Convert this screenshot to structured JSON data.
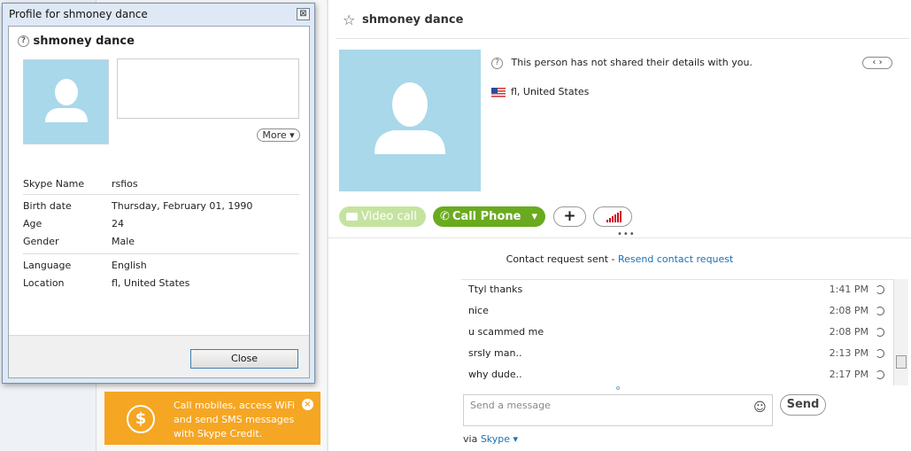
{
  "dialog": {
    "title": "Profile for shmoney dance",
    "close_x": "⊠",
    "name": "shmoney dance",
    "more_label": "More ▾",
    "fields": [
      {
        "key": "Skype Name",
        "value": "rsfios"
      },
      {
        "key": "Birth date",
        "value": "Thursday, February 01, 1990"
      },
      {
        "key": "Age",
        "value": "24"
      },
      {
        "key": "Gender",
        "value": "Male"
      },
      {
        "key": "Language",
        "value": "English"
      },
      {
        "key": "Location",
        "value": "fl, United States"
      }
    ],
    "close_button": "Close"
  },
  "ad": {
    "text": "Call mobiles, access WiFi and send SMS messages with Skype Credit.",
    "coin": "$",
    "close": "×"
  },
  "contact": {
    "name": "shmoney dance",
    "star": "☆",
    "not_shared": "This person has not shared their details with you.",
    "location": "fl, United States",
    "nav": "‹ ›"
  },
  "actions": {
    "video": "Video call",
    "call": "Call Phone",
    "call_arrow": "▾",
    "plus": "+"
  },
  "request": {
    "sent": "Contact request sent - ",
    "resend": "Resend contact request"
  },
  "messages": [
    {
      "text": "Ttyl thanks",
      "time": "1:41 PM"
    },
    {
      "text": "nice",
      "time": "2:08 PM"
    },
    {
      "text": "u scammed me",
      "time": "2:08 PM"
    },
    {
      "text": "srsly man..",
      "time": "2:13 PM"
    },
    {
      "text": "why dude..",
      "time": "2:17 PM"
    }
  ],
  "compose": {
    "placeholder": "Send a message",
    "send": "Send",
    "via_prefix": "via ",
    "via_link": "Skype ▾"
  },
  "colors": {
    "avatar_bg": "#a8d8ea",
    "call_green": "#6aaa1f",
    "video_green": "#c5e3a0",
    "ad_orange": "#f5a623",
    "link_blue": "#1c6fb5"
  }
}
